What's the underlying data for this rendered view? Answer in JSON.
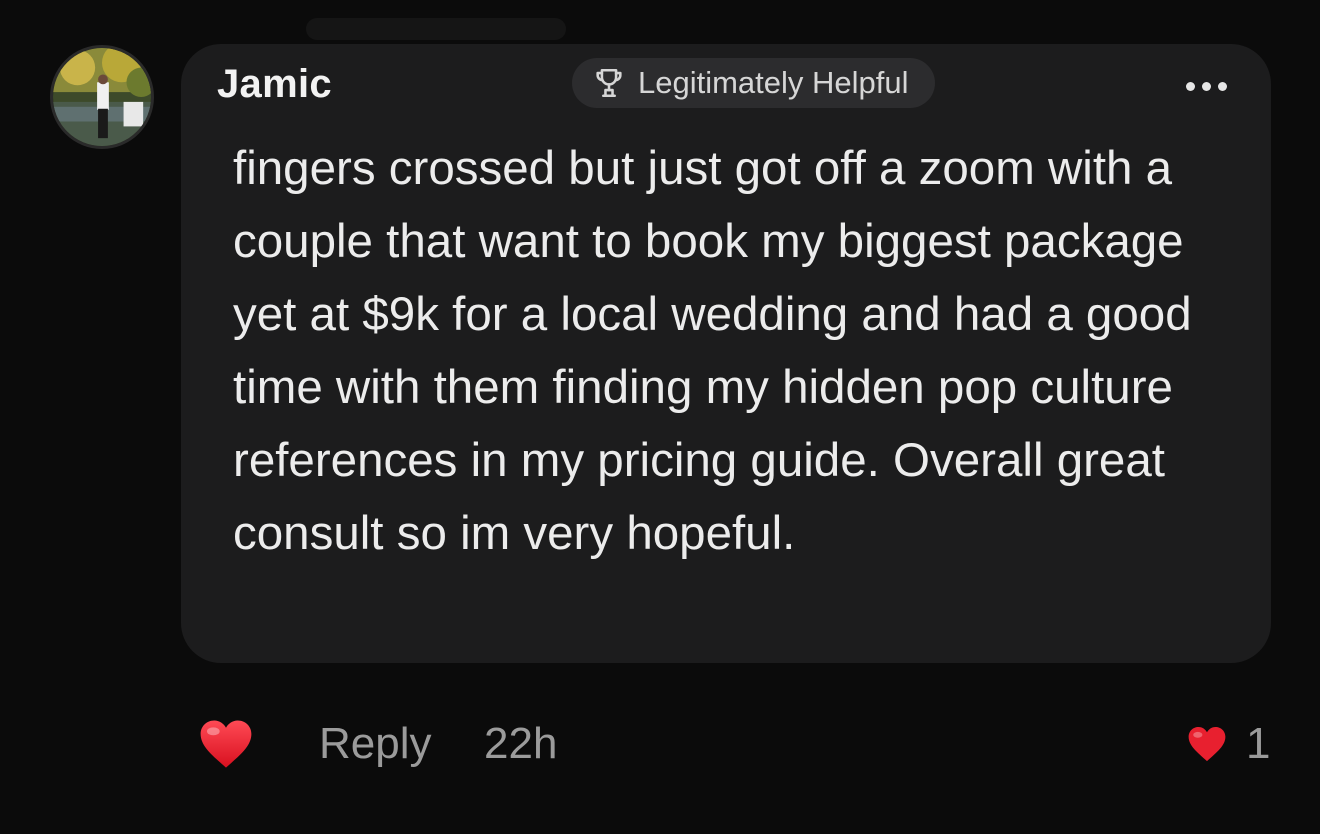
{
  "comment": {
    "author": "Jamic",
    "badge_label": "Legitimately Helpful",
    "badge_icon": "trophy-icon",
    "text": "fingers crossed but just got off a zoom with a couple that want to book my biggest package yet at $9k for a local wedding and had a good time with them finding my hidden pop culture references in my pricing guide. Overall great consult so im very hopeful.",
    "more_icon": "ellipsis-icon"
  },
  "actions": {
    "like_icon": "heart-icon",
    "reply_label": "Reply",
    "timestamp": "22h",
    "like_count": "1"
  },
  "colors": {
    "background": "#0b0b0b",
    "bubble": "#1c1c1d",
    "badge": "#2c2c2e",
    "heart": "#e8202f",
    "muted_text": "#9b9b9b"
  }
}
